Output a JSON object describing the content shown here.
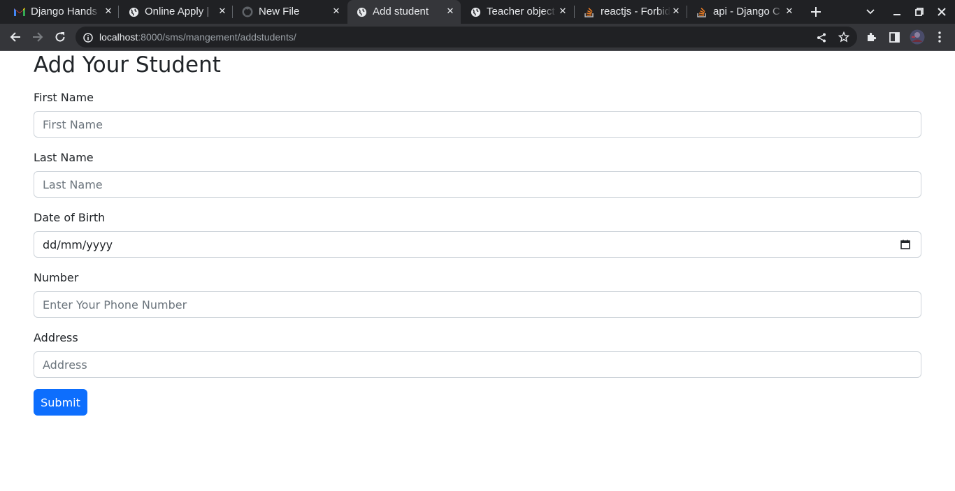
{
  "browser": {
    "tabs": [
      {
        "title": "Django Hands",
        "favicon": "gmail-icon"
      },
      {
        "title": "Online Apply |",
        "favicon": "globe-icon"
      },
      {
        "title": "New File",
        "favicon": "github-icon"
      },
      {
        "title": "Add student",
        "favicon": "globe-icon",
        "active": true
      },
      {
        "title": "Teacher object",
        "favicon": "globe-icon"
      },
      {
        "title": "reactjs - Forbid",
        "favicon": "stackoverflow-icon"
      },
      {
        "title": "api - Django C",
        "favicon": "stackoverflow-icon"
      }
    ],
    "url_host": "localhost",
    "url_rest": ":8000/sms/mangement/addstudents/"
  },
  "page": {
    "heading": "Add Your Student",
    "fields": [
      {
        "label": "First Name",
        "placeholder": "First Name"
      },
      {
        "label": "Last Name",
        "placeholder": "Last Name"
      },
      {
        "label": "Date of Birth",
        "value": "dd/mm/yyyy"
      },
      {
        "label": "Number",
        "placeholder": "Enter Your Phone Number"
      },
      {
        "label": "Address",
        "placeholder": "Address"
      }
    ],
    "submit_label": "Submit"
  },
  "colors": {
    "tabstrip_bg": "#202124",
    "toolbar_bg": "#35363a",
    "primary": "#0d6efd",
    "text": "#212529",
    "border": "#ced4da"
  }
}
